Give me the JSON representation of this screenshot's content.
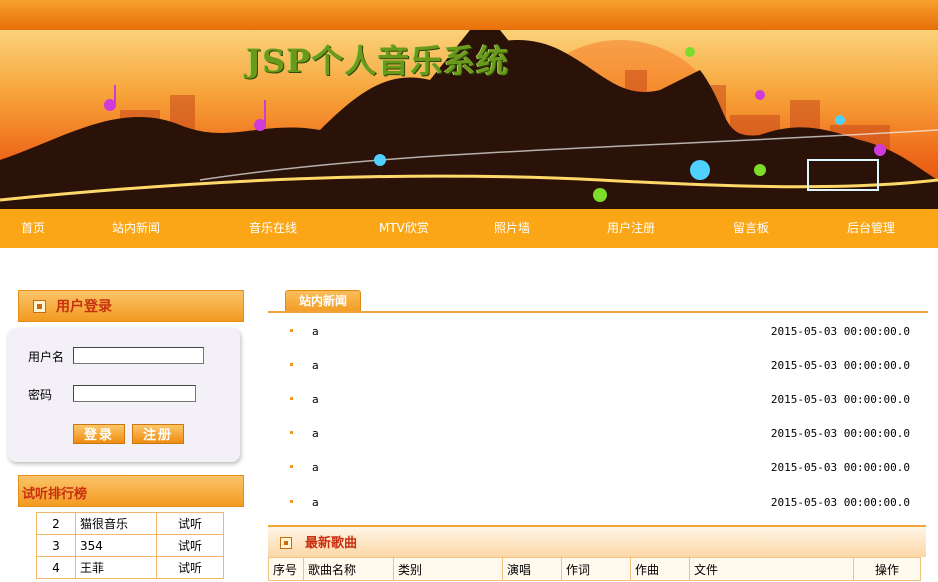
{
  "site": {
    "title": "JSP个人音乐系统"
  },
  "nav": [
    "首页",
    "站内新闻",
    "音乐在线",
    "MTV欣赏",
    "照片墙",
    "用户注册",
    "留言板",
    "后台管理"
  ],
  "login": {
    "title": "用户登录",
    "username_label": "用户名",
    "password_label": "密码",
    "username_value": "",
    "password_value": "",
    "login_button": "登录",
    "register_button": "注册"
  },
  "ranking": {
    "title": "试听排行榜",
    "rows": [
      {
        "no": "2",
        "name": "猫很音乐",
        "action": "试听"
      },
      {
        "no": "3",
        "name": "354",
        "action": "试听"
      },
      {
        "no": "4",
        "name": "王菲",
        "action": "试听"
      }
    ]
  },
  "news": {
    "tab": "站内新闻",
    "items": [
      {
        "title": "a",
        "date": "2015-05-03 00:00:00.0"
      },
      {
        "title": "a",
        "date": "2015-05-03 00:00:00.0"
      },
      {
        "title": "a",
        "date": "2015-05-03 00:00:00.0"
      },
      {
        "title": "a",
        "date": "2015-05-03 00:00:00.0"
      },
      {
        "title": "a",
        "date": "2015-05-03 00:00:00.0"
      },
      {
        "title": "a",
        "date": "2015-05-03 00:00:00.0"
      }
    ]
  },
  "songs": {
    "title": "最新歌曲",
    "columns": [
      "序号",
      "歌曲名称",
      "类别",
      "演唱",
      "作词",
      "作曲",
      "文件",
      "操作"
    ]
  },
  "colors": {
    "accent": "#fba617",
    "title_red": "#c83010",
    "border_orange": "#f1a23a"
  }
}
